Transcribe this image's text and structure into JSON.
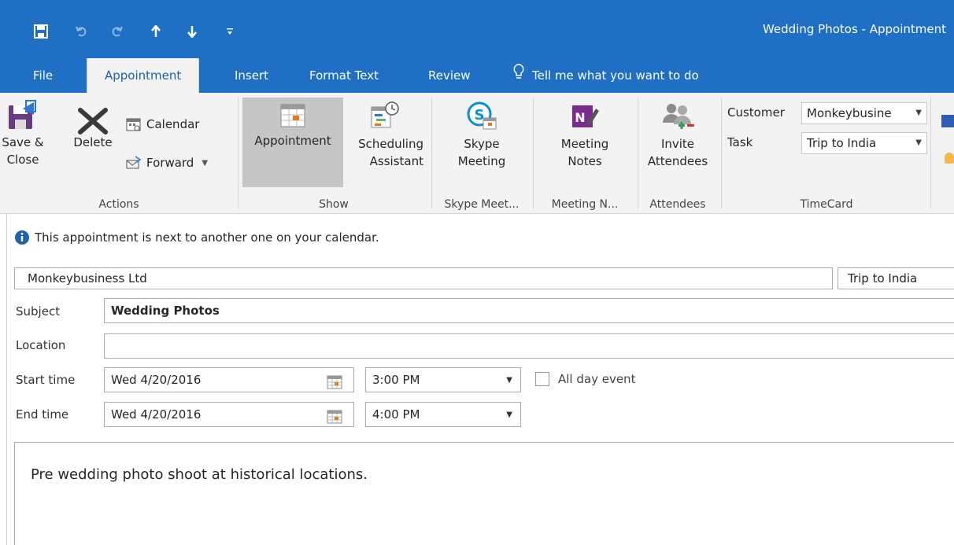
{
  "window": {
    "title": "Wedding Photos - Appointment"
  },
  "tabs": [
    {
      "label": "File"
    },
    {
      "label": "Appointment"
    },
    {
      "label": "Insert"
    },
    {
      "label": "Format Text"
    },
    {
      "label": "Review"
    }
  ],
  "tell_me": "Tell me what you want to do",
  "ribbon": {
    "actions": {
      "save_close": "Save &\nClose",
      "delete": "Delete",
      "calendar": "Calendar",
      "forward": "Forward",
      "group_label": "Actions"
    },
    "show": {
      "appointment": "Appointment",
      "scheduling": "Scheduling\nAssistant",
      "group_label": "Show"
    },
    "skype": {
      "meeting": "Skype\nMeeting",
      "group_label": "Skype Meet..."
    },
    "meeting_notes": {
      "label": "Meeting\nNotes",
      "group_label": "Meeting N..."
    },
    "attendees": {
      "invite": "Invite\nAttendees",
      "group_label": "Attendees"
    },
    "timecard": {
      "customer_label": "Customer",
      "customer_value": "Monkeybusine",
      "task_label": "Task",
      "task_value": "Trip to India",
      "group_label": "TimeCard"
    }
  },
  "info_message": "This appointment is next to another one on your calendar.",
  "form": {
    "customer_field": "Monkeybusiness Ltd",
    "task_field": "Trip to India",
    "subject_label": "Subject",
    "subject_value": "Wedding Photos",
    "location_label": "Location",
    "location_value": "",
    "start_label": "Start time",
    "start_date": "Wed 4/20/2016",
    "start_time": "3:00 PM",
    "end_label": "End time",
    "end_date": "Wed 4/20/2016",
    "end_time": "4:00 PM",
    "all_day_label": "All day event",
    "all_day_checked": false
  },
  "body_text": "Pre wedding photo shoot at historical locations.",
  "colors": {
    "titlebar": "#1f6fc5",
    "ribbon": "#f3f3f3",
    "active_tab_text": "#1f5fae"
  }
}
